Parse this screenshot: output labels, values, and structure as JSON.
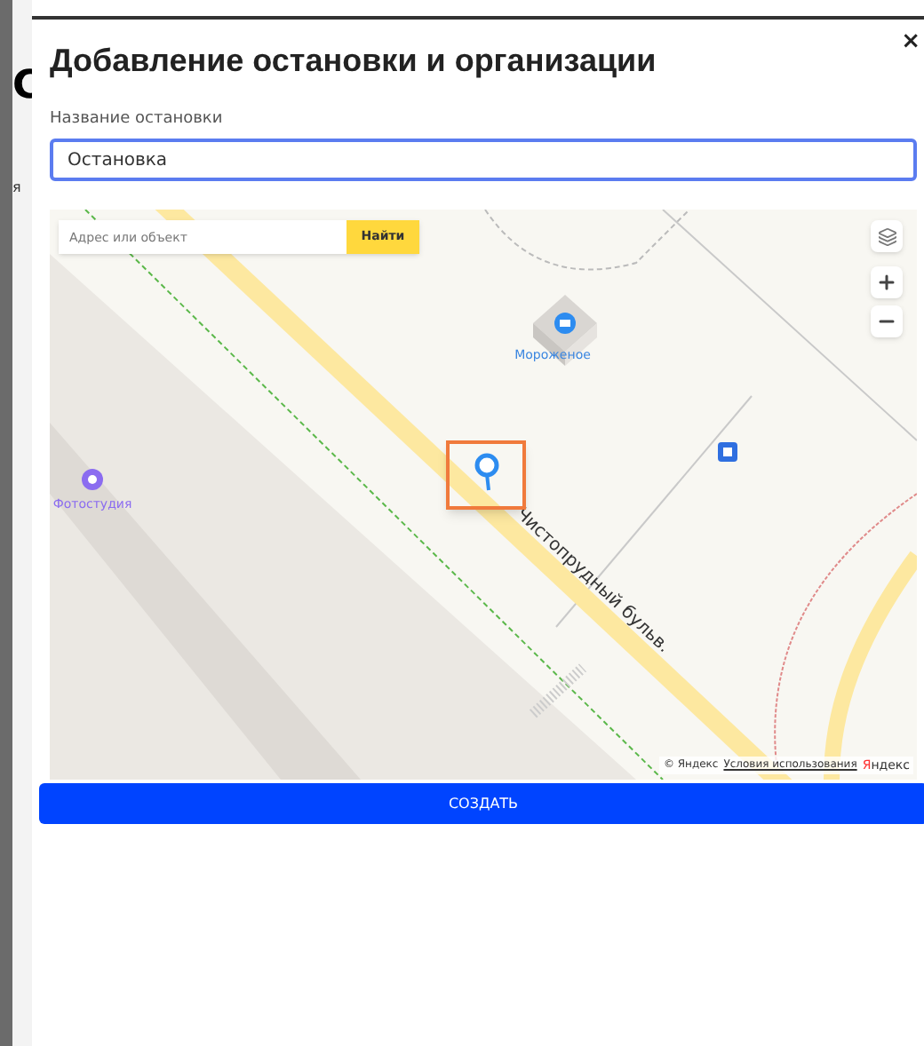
{
  "background_page": {
    "heading": "С",
    "text": "я"
  },
  "dialog": {
    "title": "Добавление остановки и организации",
    "close": "×"
  },
  "name_field": {
    "label": "Название остановки",
    "value": "Остановка",
    "focused": true
  },
  "map": {
    "search": {
      "placeholder": "Адрес или объект",
      "button": "Найти"
    },
    "places": [
      {
        "kind": "shop",
        "label": "Мороженое"
      },
      {
        "kind": "studio",
        "label": "Фотостудия"
      }
    ],
    "street": "Чистопрудный бульв.",
    "attribution": {
      "copyright": "© Яндекс",
      "terms_link": "Условия использования",
      "logo": "Яндекс"
    }
  },
  "submit_button": "СОЗДАТЬ"
}
